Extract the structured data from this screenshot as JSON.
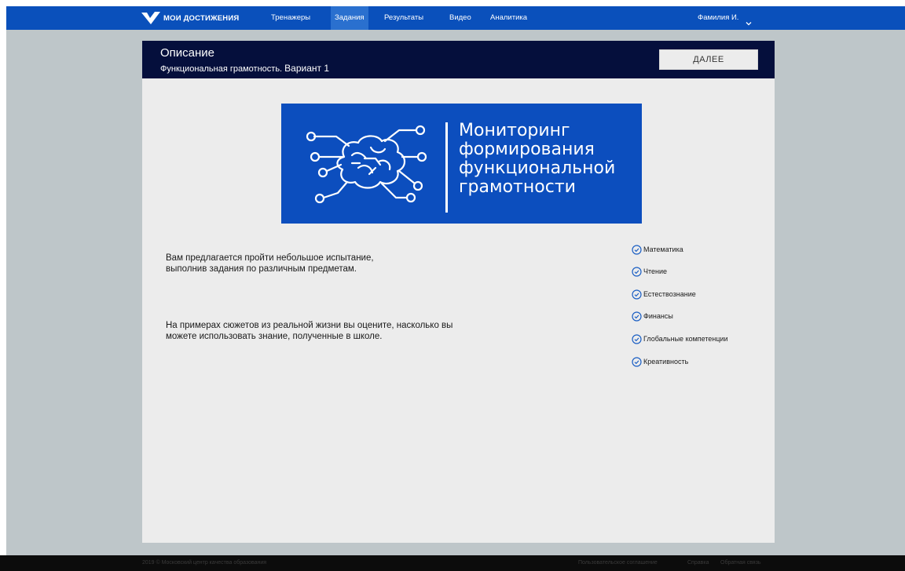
{
  "header": {
    "logo_text": "МОИ ДОСТИЖЕНИЯ",
    "nav": [
      {
        "label": "Тренажеры"
      },
      {
        "label": "Задания",
        "active": true
      },
      {
        "label": "Результаты"
      },
      {
        "label": "Видео"
      },
      {
        "label": "Аналитика"
      }
    ],
    "user_name": "Фамилия И."
  },
  "panel": {
    "title": "Описание",
    "subtitle": "Функциональная грамотность.",
    "variant": "Вариант 1",
    "next_label": "ДАЛЕЕ"
  },
  "banner": {
    "lines": [
      "Мониторинг",
      "формирования",
      "функциональной",
      "грамотности"
    ]
  },
  "content": {
    "paragraph1": "Вам предлагается пройти небольшое испытание, выполнив задания по различным предметам.",
    "paragraph2": "На примерах сюжетов из реальной жизни вы оцените, насколько вы можете использовать знание, полученные в школе."
  },
  "subjects": [
    "Математика",
    "Чтение",
    "Естествознание",
    "Финансы",
    "Глобальные компетенции",
    "Креативность"
  ],
  "footer": {
    "copyright": "2019 © Московский центр качества образования",
    "links": [
      "Пользовательское соглашение",
      "Справка",
      "Обратная связь"
    ]
  },
  "colors": {
    "nav_bg": "#0a50bb",
    "panel_header_bg": "#050f3c",
    "banner_bg": "#0c4ebe",
    "page_bg": "#bec6c9",
    "footer_bg": "#0c0c0c"
  }
}
